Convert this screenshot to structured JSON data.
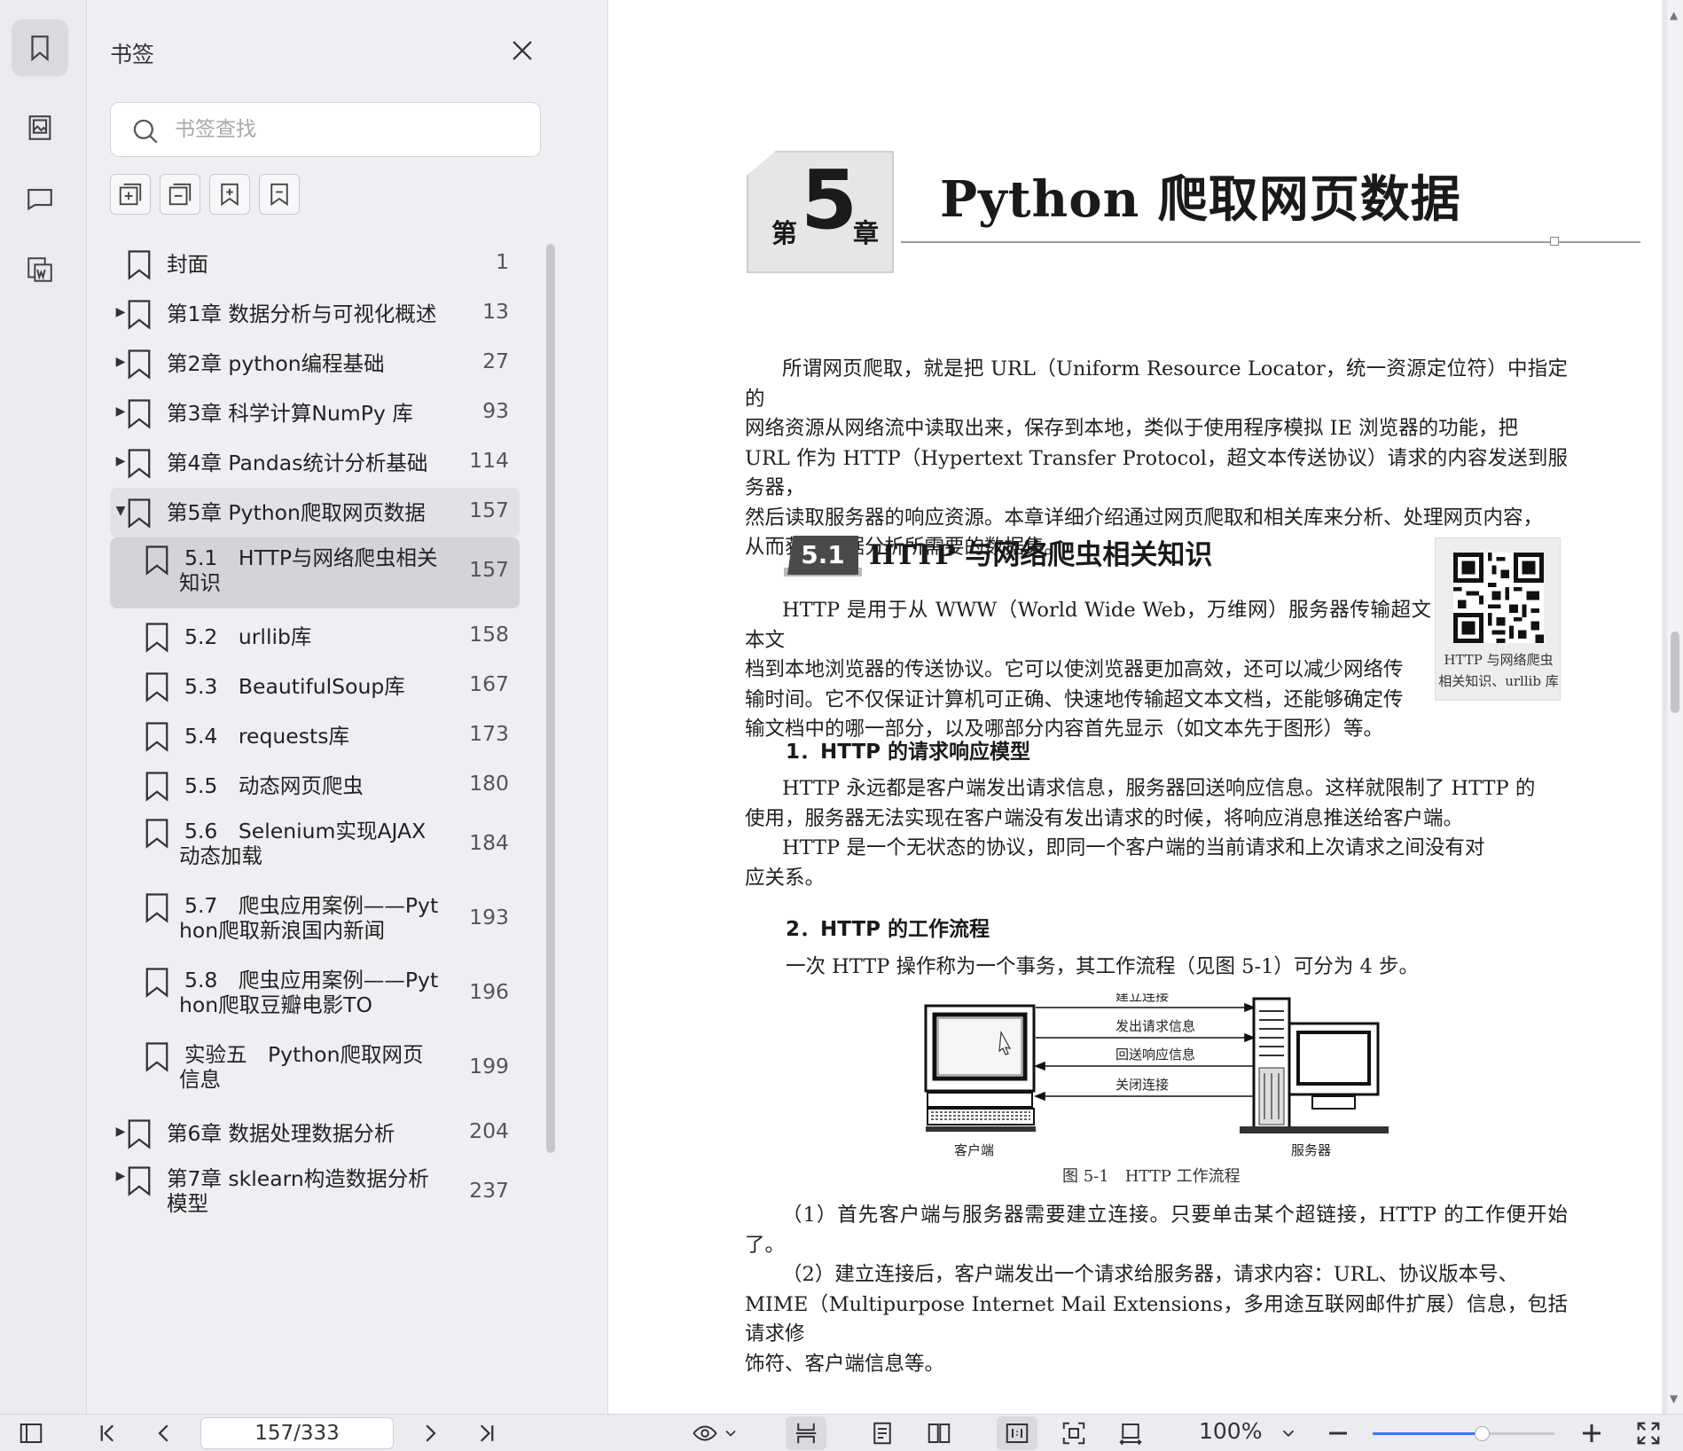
{
  "panel": {
    "title": "书签",
    "search_placeholder": "书签查找"
  },
  "toc": [
    {
      "label": "封面",
      "page": "1",
      "level": 0,
      "expandable": false
    },
    {
      "label": "第1章 数据分析与可视化概述",
      "page": "13",
      "level": 0,
      "expandable": true
    },
    {
      "label": "第2章 python编程基础",
      "page": "27",
      "level": 0,
      "expandable": true
    },
    {
      "label": "第3章 科学计算NumPy 库",
      "page": "93",
      "level": 0,
      "expandable": true
    },
    {
      "label": "第4章 Pandas统计分析基础",
      "page": "114",
      "level": 0,
      "expandable": true
    },
    {
      "label": "第5章 Python爬取网页数据",
      "page": "157",
      "level": 0,
      "expandable": true,
      "expanded": true
    },
    {
      "label_l1": "5.1　HTTP与网络爬虫相关",
      "label_l2": "知识",
      "page": "157",
      "level": 1
    },
    {
      "label": "5.2　urllib库",
      "page": "158",
      "level": 1
    },
    {
      "label": "5.3　BeautifulSoup库",
      "page": "167",
      "level": 1
    },
    {
      "label": "5.4　requests库",
      "page": "173",
      "level": 1
    },
    {
      "label": "5.5　动态网页爬虫",
      "page": "180",
      "level": 1
    },
    {
      "label_l1": "5.6　Selenium实现AJAX",
      "label_l2": "动态加载",
      "page": "184",
      "level": 1
    },
    {
      "label_l1": "5.7　爬虫应用案例——Pyt",
      "label_l2": "hon爬取新浪国内新闻",
      "page": "193",
      "level": 1
    },
    {
      "label_l1": "5.8　爬虫应用案例——Pyt",
      "label_l2": "hon爬取豆瓣电影TO",
      "page": "196",
      "level": 1
    },
    {
      "label_l1": "实验五　Python爬取网页",
      "label_l2": "信息",
      "page": "199",
      "level": 1
    },
    {
      "label": "第6章 数据处理数据分析",
      "page": "204",
      "level": 0,
      "expandable": true
    },
    {
      "label_l1": "第7章 sklearn构造数据分析",
      "label_l2": "模型",
      "page": "237",
      "level": 0,
      "expandable": true
    }
  ],
  "doc": {
    "chapter_di": "第",
    "chapter_num": "5",
    "chapter_zhang": "章",
    "chapter_title": "Python 爬取网页数据",
    "intro_lines": [
      "所谓网页爬取，就是把 URL（Uniform Resource Locator，统一资源定位符）中指定的",
      "网络资源从网络流中读取出来，保存到本地，类似于使用程序模拟 IE 浏览器的功能，把",
      "URL 作为 HTTP（Hypertext Transfer Protocol，超文本传送协议）请求的内容发送到服务器，",
      "然后读取服务器的响应资源。本章详细介绍通过网页爬取和相关库来分析、处理网页内容，",
      "从而获取数据分析所需要的数据集。"
    ],
    "section_num": "5.1",
    "section_title": "HTTP 与网络爬虫相关知识",
    "section_lines": [
      "HTTP 是用于从 WWW（World Wide Web，万维网）服务器传输超文本文",
      "档到本地浏览器的传送协议。它可以使浏览器更加高效，还可以减少网络传",
      "输时间。它不仅保证计算机可正确、快速地传输超文本文档，还能够确定传",
      "输文档中的哪一部分，以及哪部分内容首先显示（如文本先于图形）等。"
    ],
    "qr_caption_1": "HTTP 与网络爬虫",
    "qr_caption_2": "相关知识、urllib 库",
    "sub1": "1．HTTP 的请求响应模型",
    "sub1_lines": [
      "HTTP 永远都是客户端发出请求信息，服务器回送响应信息。这样就限制了 HTTP 的",
      "使用，服务器无法实现在客户端没有发出请求的时候，将响应消息推送给客户端。",
      "HTTP 是一个无状态的协议，即同一个客户端的当前请求和上次请求之间没有对",
      "应关系。"
    ],
    "sub2": "2．HTTP 的工作流程",
    "sub2_line": "一次 HTTP 操作称为一个事务，其工作流程（见图 5-1）可分为 4 步。",
    "fig_labels": [
      "建立连接",
      "发出请求信息",
      "回送响应信息",
      "关闭连接"
    ],
    "fig_client": "客户端",
    "fig_server": "服务器",
    "fig_caption": "图 5-1　HTTP 工作流程",
    "step_lines": [
      "（1）首先客户端与服务器需要建立连接。只要单击某个超链接，HTTP 的工作便开始了。",
      "（2）建立连接后，客户端发出一个请求给服务器，请求内容：URL、协议版本号、",
      "MIME（Multipurpose Internet Mail Extensions，多用途互联网邮件扩展）信息，包括请求修",
      "饰符、客户端信息等。"
    ]
  },
  "bottombar": {
    "page_indicator": "157/333",
    "zoom": "100%",
    "zoom_fraction": 0.6
  },
  "colors": {
    "accent": "#3478f6"
  }
}
